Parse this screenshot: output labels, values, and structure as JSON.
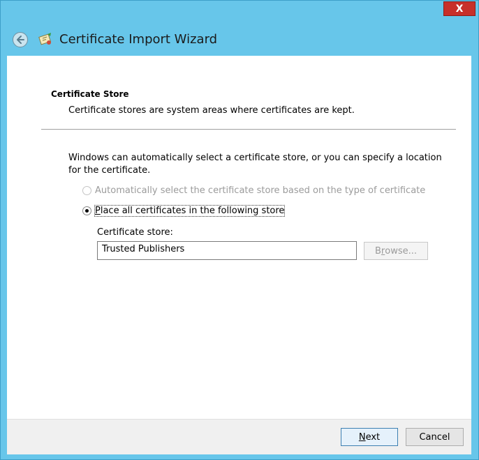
{
  "window": {
    "title": "Certificate Import Wizard",
    "close_label": "X"
  },
  "section": {
    "title": "Certificate Store",
    "description": "Certificate stores are system areas where certificates are kept."
  },
  "intro_text": "Windows can automatically select a certificate store, or you can specify a location for the certificate.",
  "options": [
    {
      "label_prefix": "A",
      "label_rest": "utomatically select the certificate store based on the type of certificate",
      "selected": false,
      "enabled": false
    },
    {
      "label_prefix": "P",
      "label_rest": "lace all certificates in the following store",
      "selected": true,
      "enabled": true
    }
  ],
  "store": {
    "label": "Certificate store:",
    "value": "Trusted Publishers",
    "browse_prefix": "B",
    "browse_accel": "r",
    "browse_rest": "owse..."
  },
  "footer": {
    "next_accel": "N",
    "next_rest": "ext",
    "cancel_label": "Cancel"
  },
  "colors": {
    "frame": "#67c6ea",
    "close": "#c7302a",
    "content_bg": "#ffffff",
    "footer_bg": "#f0f0f0"
  }
}
